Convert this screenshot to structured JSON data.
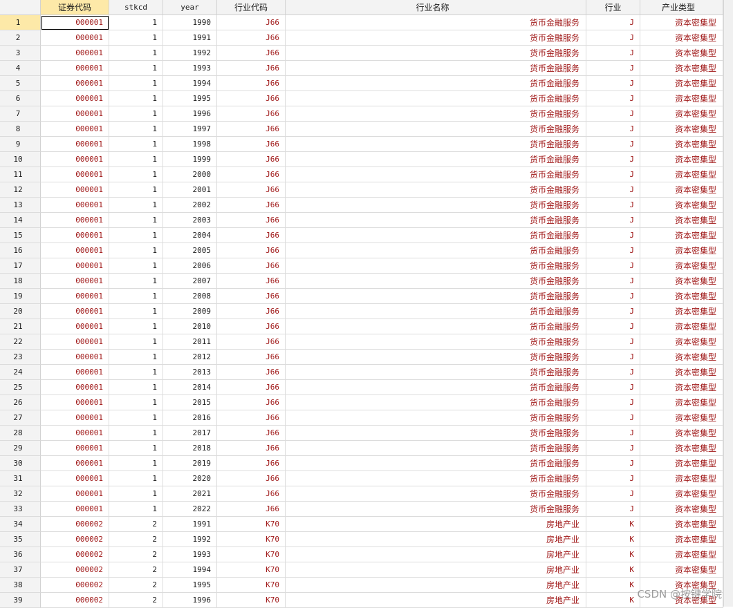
{
  "columns": [
    "证券代码",
    "stkcd",
    "year",
    "行业代码",
    "行业名称",
    "行业",
    "产业类型"
  ],
  "rows": [
    [
      "1",
      "000001",
      "1",
      "1990",
      "J66",
      "货币金融服务",
      "J",
      "资本密集型"
    ],
    [
      "2",
      "000001",
      "1",
      "1991",
      "J66",
      "货币金融服务",
      "J",
      "资本密集型"
    ],
    [
      "3",
      "000001",
      "1",
      "1992",
      "J66",
      "货币金融服务",
      "J",
      "资本密集型"
    ],
    [
      "4",
      "000001",
      "1",
      "1993",
      "J66",
      "货币金融服务",
      "J",
      "资本密集型"
    ],
    [
      "5",
      "000001",
      "1",
      "1994",
      "J66",
      "货币金融服务",
      "J",
      "资本密集型"
    ],
    [
      "6",
      "000001",
      "1",
      "1995",
      "J66",
      "货币金融服务",
      "J",
      "资本密集型"
    ],
    [
      "7",
      "000001",
      "1",
      "1996",
      "J66",
      "货币金融服务",
      "J",
      "资本密集型"
    ],
    [
      "8",
      "000001",
      "1",
      "1997",
      "J66",
      "货币金融服务",
      "J",
      "资本密集型"
    ],
    [
      "9",
      "000001",
      "1",
      "1998",
      "J66",
      "货币金融服务",
      "J",
      "资本密集型"
    ],
    [
      "10",
      "000001",
      "1",
      "1999",
      "J66",
      "货币金融服务",
      "J",
      "资本密集型"
    ],
    [
      "11",
      "000001",
      "1",
      "2000",
      "J66",
      "货币金融服务",
      "J",
      "资本密集型"
    ],
    [
      "12",
      "000001",
      "1",
      "2001",
      "J66",
      "货币金融服务",
      "J",
      "资本密集型"
    ],
    [
      "13",
      "000001",
      "1",
      "2002",
      "J66",
      "货币金融服务",
      "J",
      "资本密集型"
    ],
    [
      "14",
      "000001",
      "1",
      "2003",
      "J66",
      "货币金融服务",
      "J",
      "资本密集型"
    ],
    [
      "15",
      "000001",
      "1",
      "2004",
      "J66",
      "货币金融服务",
      "J",
      "资本密集型"
    ],
    [
      "16",
      "000001",
      "1",
      "2005",
      "J66",
      "货币金融服务",
      "J",
      "资本密集型"
    ],
    [
      "17",
      "000001",
      "1",
      "2006",
      "J66",
      "货币金融服务",
      "J",
      "资本密集型"
    ],
    [
      "18",
      "000001",
      "1",
      "2007",
      "J66",
      "货币金融服务",
      "J",
      "资本密集型"
    ],
    [
      "19",
      "000001",
      "1",
      "2008",
      "J66",
      "货币金融服务",
      "J",
      "资本密集型"
    ],
    [
      "20",
      "000001",
      "1",
      "2009",
      "J66",
      "货币金融服务",
      "J",
      "资本密集型"
    ],
    [
      "21",
      "000001",
      "1",
      "2010",
      "J66",
      "货币金融服务",
      "J",
      "资本密集型"
    ],
    [
      "22",
      "000001",
      "1",
      "2011",
      "J66",
      "货币金融服务",
      "J",
      "资本密集型"
    ],
    [
      "23",
      "000001",
      "1",
      "2012",
      "J66",
      "货币金融服务",
      "J",
      "资本密集型"
    ],
    [
      "24",
      "000001",
      "1",
      "2013",
      "J66",
      "货币金融服务",
      "J",
      "资本密集型"
    ],
    [
      "25",
      "000001",
      "1",
      "2014",
      "J66",
      "货币金融服务",
      "J",
      "资本密集型"
    ],
    [
      "26",
      "000001",
      "1",
      "2015",
      "J66",
      "货币金融服务",
      "J",
      "资本密集型"
    ],
    [
      "27",
      "000001",
      "1",
      "2016",
      "J66",
      "货币金融服务",
      "J",
      "资本密集型"
    ],
    [
      "28",
      "000001",
      "1",
      "2017",
      "J66",
      "货币金融服务",
      "J",
      "资本密集型"
    ],
    [
      "29",
      "000001",
      "1",
      "2018",
      "J66",
      "货币金融服务",
      "J",
      "资本密集型"
    ],
    [
      "30",
      "000001",
      "1",
      "2019",
      "J66",
      "货币金融服务",
      "J",
      "资本密集型"
    ],
    [
      "31",
      "000001",
      "1",
      "2020",
      "J66",
      "货币金融服务",
      "J",
      "资本密集型"
    ],
    [
      "32",
      "000001",
      "1",
      "2021",
      "J66",
      "货币金融服务",
      "J",
      "资本密集型"
    ],
    [
      "33",
      "000001",
      "1",
      "2022",
      "J66",
      "货币金融服务",
      "J",
      "资本密集型"
    ],
    [
      "34",
      "000002",
      "2",
      "1991",
      "K70",
      "房地产业",
      "K",
      "资本密集型"
    ],
    [
      "35",
      "000002",
      "2",
      "1992",
      "K70",
      "房地产业",
      "K",
      "资本密集型"
    ],
    [
      "36",
      "000002",
      "2",
      "1993",
      "K70",
      "房地产业",
      "K",
      "资本密集型"
    ],
    [
      "37",
      "000002",
      "2",
      "1994",
      "K70",
      "房地产业",
      "K",
      "资本密集型"
    ],
    [
      "38",
      "000002",
      "2",
      "1995",
      "K70",
      "房地产业",
      "K",
      "资本密集型"
    ],
    [
      "39",
      "000002",
      "2",
      "1996",
      "K70",
      "房地产业",
      "K",
      "资本密集型"
    ]
  ],
  "selected_row": "1",
  "selected_column": "证券代码",
  "watermark": "CSDN @按键学院",
  "colors": {
    "string_value": "#a01818",
    "numeric_value": "#1a1a1a",
    "selection": "#fde9a8"
  }
}
